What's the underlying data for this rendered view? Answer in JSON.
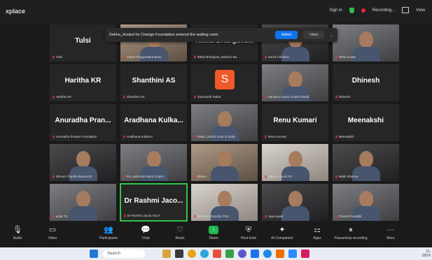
{
  "app": {
    "title": "xplace"
  },
  "topbar": {
    "signin": "Sign in",
    "recording": "Recording...",
    "view": "View"
  },
  "notification": {
    "text": "Dekha_Anukul for Change Foundation entered the waiting room",
    "admit": "Admit",
    "view": "View"
  },
  "participants": [
    {
      "name": "Tulsi",
      "label": "Tulsi",
      "type": "name"
    },
    {
      "name": "",
      "label": "ARUN Pragyaratna Boss",
      "type": "video"
    },
    {
      "name": "Ritika Bhargava...",
      "label": "Ritika Bhargava_Mission Ba...",
      "type": "name"
    },
    {
      "name": "",
      "label": "Sumit Chhabra",
      "type": "video"
    },
    {
      "name": "",
      "label": "Neha Gupta",
      "type": "video"
    },
    {
      "name": "Haritha KR",
      "label": "Haritha KR",
      "type": "name"
    },
    {
      "name": "Shanthini AS",
      "label": "Shanthini AS",
      "type": "name"
    },
    {
      "name": "S",
      "label": "Shamanth Sakat",
      "type": "avatar"
    },
    {
      "name": "",
      "label": "Sanjeevi Kausir South Dharid",
      "type": "video"
    },
    {
      "name": "Dhinesh",
      "label": "Dhinesh",
      "type": "name"
    },
    {
      "name": "Anuradha Pran...",
      "label": "Anuradha Pranav Foundation",
      "type": "name"
    },
    {
      "name": "Aradhana Kulka...",
      "label": "Aradhana Kulkarni",
      "type": "name"
    },
    {
      "name": "",
      "label": "Ratan_NeGD Govt of India",
      "type": "video"
    },
    {
      "name": "Renu Kumari",
      "label": "Renu Kumari",
      "type": "name"
    },
    {
      "name": "Meenakshi",
      "label": "Meenakshi",
      "type": "name"
    },
    {
      "name": "",
      "label": "Shivani Tripathi Beyond B",
      "type": "video"
    },
    {
      "name": "",
      "label": "Pio Lakhorab Ranji Project",
      "type": "video"
    },
    {
      "name": "",
      "label": "Bhanu",
      "type": "video"
    },
    {
      "name": "",
      "label": "Aleena Jacob PS",
      "type": "video"
    },
    {
      "name": "",
      "label": "Mitali Sharma",
      "type": "video"
    },
    {
      "name": "",
      "label": "anita TS",
      "type": "video"
    },
    {
      "name": "Dr Rashmi Jaco...",
      "label": "Dr Rashmi Jacob HCLF",
      "type": "name"
    },
    {
      "name": "",
      "label": "Jyotsna Chandok PSS",
      "type": "video"
    },
    {
      "name": "",
      "label": "Jaya anjali",
      "type": "video"
    },
    {
      "name": "",
      "label": "Pranali Pundalik",
      "type": "video"
    }
  ],
  "toolbar": [
    {
      "label": "Audio",
      "icon": "mic-icon",
      "glyph": "🎙"
    },
    {
      "label": "Video",
      "icon": "video-icon",
      "glyph": "▭"
    },
    {
      "label": "Participants",
      "icon": "participants-icon",
      "glyph": "👥",
      "badge": "61"
    },
    {
      "label": "Chat",
      "icon": "chat-icon",
      "glyph": "💬"
    },
    {
      "label": "React",
      "icon": "react-icon",
      "glyph": "♡"
    },
    {
      "label": "Share",
      "icon": "share-icon",
      "glyph": "↑"
    },
    {
      "label": "Host tools",
      "icon": "shield-icon",
      "glyph": "⛨"
    },
    {
      "label": "AI Companion",
      "icon": "sparkle-icon",
      "glyph": "✦"
    },
    {
      "label": "Apps",
      "icon": "apps-icon",
      "glyph": "⚏"
    },
    {
      "label": "Pause/stop recording",
      "icon": "pause-icon",
      "glyph": "⏸"
    },
    {
      "label": "More",
      "icon": "more-icon",
      "glyph": "···"
    }
  ],
  "taskbar": {
    "search_placeholder": "Search",
    "time": "11:",
    "date": "18/16"
  }
}
